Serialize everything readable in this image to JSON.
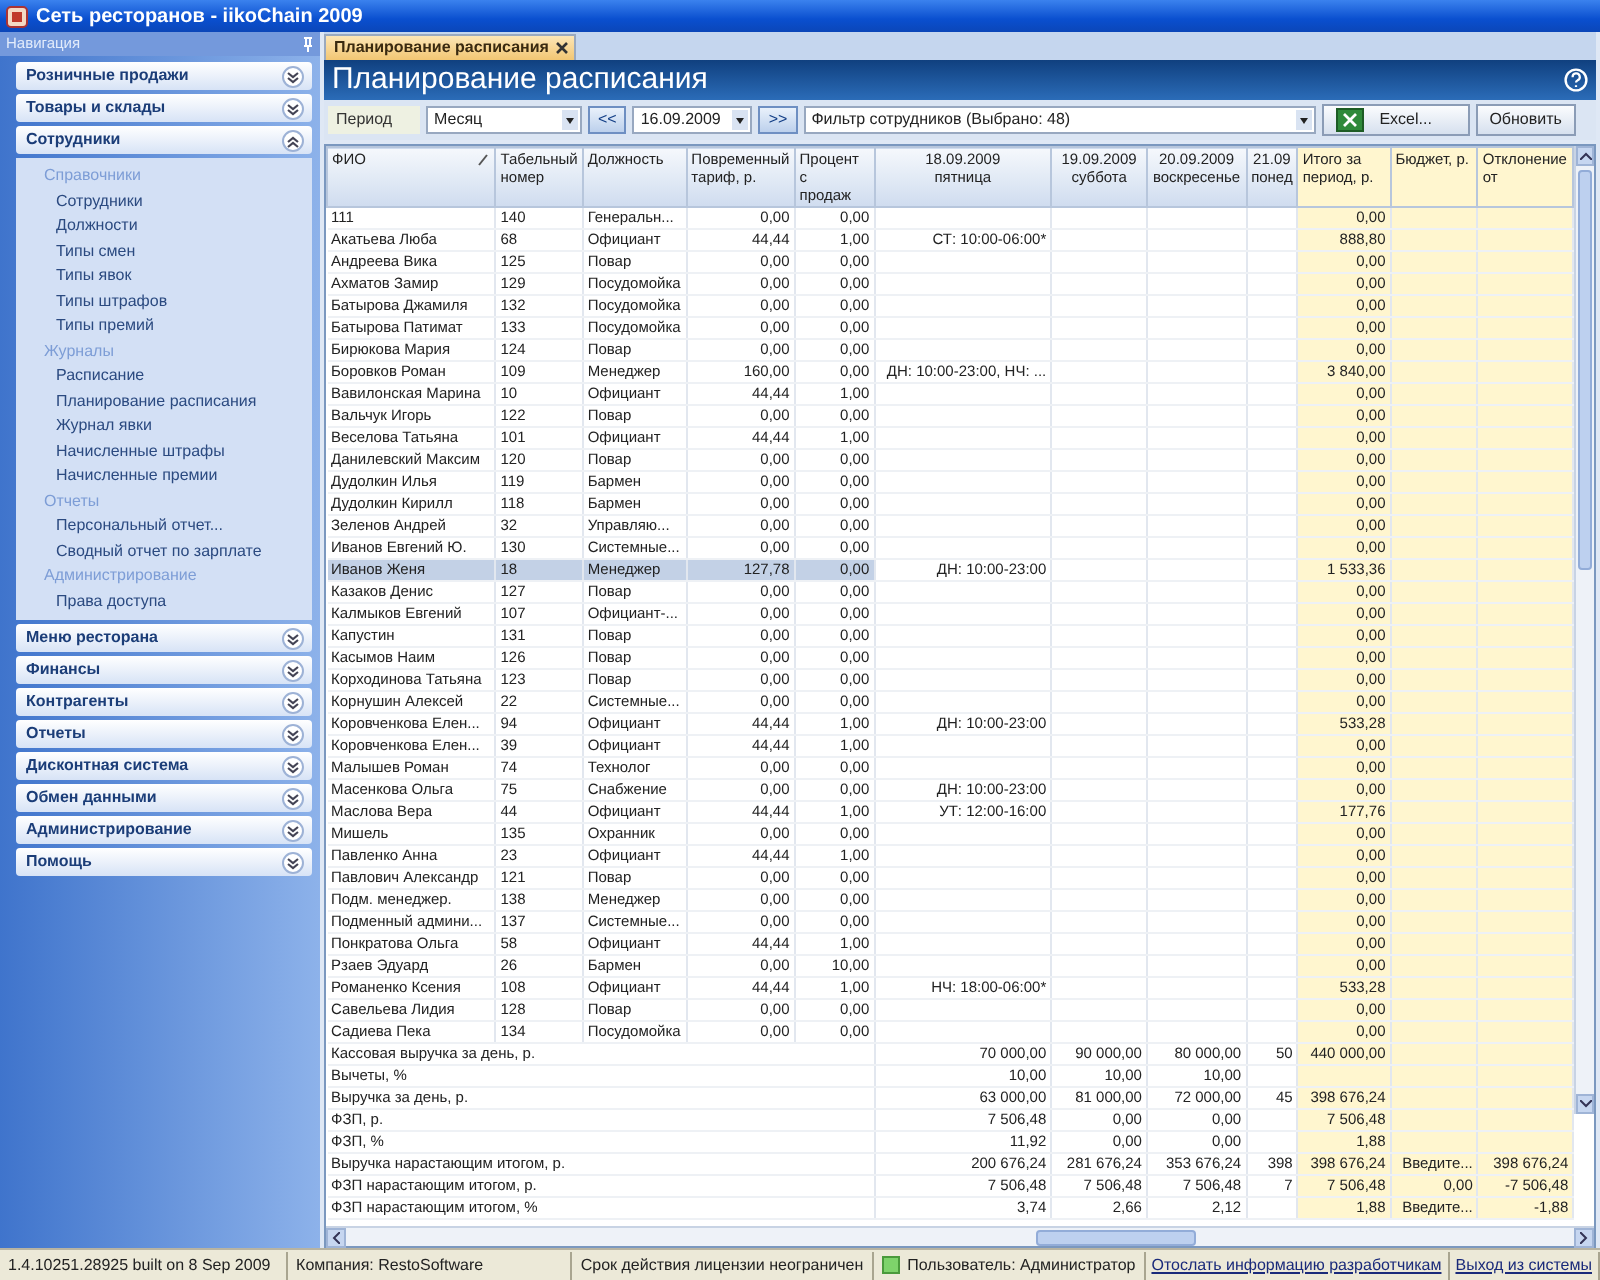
{
  "window": {
    "title": "Сеть ресторанов - iikoChain 2009"
  },
  "navigation": {
    "title": "Навигация",
    "sections": [
      {
        "label": "Розничные продажи",
        "expanded": false
      },
      {
        "label": "Товары и склады",
        "expanded": false
      },
      {
        "label": "Сотрудники",
        "expanded": true,
        "groups": [
          {
            "label": "Справочники",
            "items": [
              "Сотрудники",
              "Должности",
              "Типы смен",
              "Типы явок",
              "Типы штрафов",
              "Типы премий"
            ]
          },
          {
            "label": "Журналы",
            "items": [
              "Расписание",
              "Планирование расписания",
              "Журнал явки",
              "Начисленные штрафы",
              "Начисленные премии"
            ]
          },
          {
            "label": "Отчеты",
            "items": [
              "Персональный отчет...",
              "Сводный отчет по зарплате"
            ]
          },
          {
            "label": "Администрирование",
            "items": [
              "Права доступа"
            ]
          }
        ]
      },
      {
        "label": "Меню ресторана",
        "expanded": false
      },
      {
        "label": "Финансы",
        "expanded": false
      },
      {
        "label": "Контрагенты",
        "expanded": false
      },
      {
        "label": "Отчеты",
        "expanded": false
      },
      {
        "label": "Дисконтная система",
        "expanded": false
      },
      {
        "label": "Обмен данными",
        "expanded": false
      },
      {
        "label": "Администрирование",
        "expanded": false
      },
      {
        "label": "Помощь",
        "expanded": false
      }
    ]
  },
  "tab": {
    "label": "Планирование расписания"
  },
  "page_title": "Планирование расписания",
  "toolbar": {
    "period_label": "Период",
    "period": "Месяц",
    "prev": "<<",
    "date": "16.09.2009",
    "next": ">>",
    "filter": "Фильтр сотрудников (Выбрано: 48)",
    "excel": "Excel...",
    "refresh": "Обновить"
  },
  "table": {
    "columns": [
      {
        "lines": [
          "ФИО"
        ],
        "sorted": true
      },
      {
        "lines": [
          "Табельный",
          "номер"
        ],
        "sorted": false
      },
      {
        "lines": [
          "Должность"
        ],
        "sorted": false
      },
      {
        "lines": [
          "Повременный",
          "тариф, р."
        ],
        "sorted": false
      },
      {
        "lines": [
          "Процент с",
          "продаж"
        ],
        "sorted": false
      },
      {
        "lines": [
          "18.09.2009",
          "пятница"
        ],
        "sorted": false
      },
      {
        "lines": [
          "19.09.2009",
          "суббота"
        ],
        "sorted": false
      },
      {
        "lines": [
          "20.09.2009",
          "воскресенье"
        ],
        "sorted": false
      },
      {
        "lines": [
          "21.09",
          "понед"
        ],
        "sorted": false
      },
      {
        "lines": [
          "Итого за",
          "период, р."
        ],
        "sorted": false
      },
      {
        "lines": [
          "Бюджет, р."
        ],
        "sorted": false
      },
      {
        "lines": [
          "Отклонение",
          "от"
        ],
        "sorted": false
      }
    ],
    "rows": [
      {
        "name": "111",
        "number": "140",
        "position": "Генеральн...",
        "tariff": "0,00",
        "percent": "0,00",
        "total": "0,00",
        "selected": false
      },
      {
        "name": "Акатьева Люба",
        "number": "68",
        "position": "Официант",
        "tariff": "44,44",
        "percent": "1,00",
        "day_1": "СТ: 10:00-06:00*",
        "total": "888,80",
        "selected": false
      },
      {
        "name": "Андреева Вика",
        "number": "125",
        "position": "Повар",
        "tariff": "0,00",
        "percent": "0,00",
        "total": "0,00",
        "selected": false
      },
      {
        "name": "Ахматов Замир",
        "number": "129",
        "position": "Посудомойка",
        "tariff": "0,00",
        "percent": "0,00",
        "total": "0,00",
        "selected": false
      },
      {
        "name": "Батырова Джамиля",
        "number": "132",
        "position": "Посудомойка",
        "tariff": "0,00",
        "percent": "0,00",
        "total": "0,00",
        "selected": false
      },
      {
        "name": "Батырова Патимат",
        "number": "133",
        "position": "Посудомойка",
        "tariff": "0,00",
        "percent": "0,00",
        "total": "0,00",
        "selected": false
      },
      {
        "name": "Бирюкова Мария",
        "number": "124",
        "position": "Повар",
        "tariff": "0,00",
        "percent": "0,00",
        "total": "0,00",
        "selected": false
      },
      {
        "name": "Боровков Роман",
        "number": "109",
        "position": "Менеджер",
        "tariff": "160,00",
        "percent": "0,00",
        "day_1": "ДН: 10:00-23:00, НЧ: ...",
        "total": "3 840,00",
        "selected": false
      },
      {
        "name": "Вавилонская Марина",
        "number": "10",
        "position": "Официант",
        "tariff": "44,44",
        "percent": "1,00",
        "total": "0,00",
        "selected": false
      },
      {
        "name": "Вальчук Игорь",
        "number": "122",
        "position": "Повар",
        "tariff": "0,00",
        "percent": "0,00",
        "total": "0,00",
        "selected": false
      },
      {
        "name": "Веселова Татьяна",
        "number": "101",
        "position": "Официант",
        "tariff": "44,44",
        "percent": "1,00",
        "total": "0,00",
        "selected": false
      },
      {
        "name": "Данилевский Максим",
        "number": "120",
        "position": "Повар",
        "tariff": "0,00",
        "percent": "0,00",
        "total": "0,00",
        "selected": false
      },
      {
        "name": "Дудолкин Илья",
        "number": "119",
        "position": "Бармен",
        "tariff": "0,00",
        "percent": "0,00",
        "total": "0,00",
        "selected": false
      },
      {
        "name": "Дудолкин Кирилл",
        "number": "118",
        "position": "Бармен",
        "tariff": "0,00",
        "percent": "0,00",
        "total": "0,00",
        "selected": false
      },
      {
        "name": "Зеленов Андрей",
        "number": "32",
        "position": "Управляю...",
        "tariff": "0,00",
        "percent": "0,00",
        "total": "0,00",
        "selected": false
      },
      {
        "name": "Иванов Евгений Ю.",
        "number": "130",
        "position": "Системные...",
        "tariff": "0,00",
        "percent": "0,00",
        "total": "0,00",
        "selected": false
      },
      {
        "name": "Иванов Женя",
        "number": "18",
        "position": "Менеджер",
        "tariff": "127,78",
        "percent": "0,00",
        "day_1": "ДН: 10:00-23:00",
        "total": "1 533,36",
        "selected": true
      },
      {
        "name": "Казаков Денис",
        "number": "127",
        "position": "Повар",
        "tariff": "0,00",
        "percent": "0,00",
        "total": "0,00",
        "selected": false
      },
      {
        "name": "Калмыков Евгений",
        "number": "107",
        "position": "Официант-...",
        "tariff": "0,00",
        "percent": "0,00",
        "total": "0,00",
        "selected": false
      },
      {
        "name": "Капустин",
        "number": "131",
        "position": "Повар",
        "tariff": "0,00",
        "percent": "0,00",
        "total": "0,00",
        "selected": false
      },
      {
        "name": "Касымов Наим",
        "number": "126",
        "position": "Повар",
        "tariff": "0,00",
        "percent": "0,00",
        "total": "0,00",
        "selected": false
      },
      {
        "name": "Корходинова Татьяна",
        "number": "123",
        "position": "Повар",
        "tariff": "0,00",
        "percent": "0,00",
        "total": "0,00",
        "selected": false
      },
      {
        "name": "Корнушин Алексей",
        "number": "22",
        "position": "Системные...",
        "tariff": "0,00",
        "percent": "0,00",
        "total": "0,00",
        "selected": false
      },
      {
        "name": "Коровченкова Елен...",
        "number": "94",
        "position": "Официант",
        "tariff": "44,44",
        "percent": "1,00",
        "day_1": "ДН: 10:00-23:00",
        "total": "533,28",
        "selected": false
      },
      {
        "name": "Коровченкова Елен...",
        "number": "39",
        "position": "Официант",
        "tariff": "44,44",
        "percent": "1,00",
        "total": "0,00",
        "selected": false
      },
      {
        "name": "Малышев Роман",
        "number": "74",
        "position": "Технолог",
        "tariff": "0,00",
        "percent": "0,00",
        "total": "0,00",
        "selected": false
      },
      {
        "name": "Масенкова Ольга",
        "number": "75",
        "position": "Снабжение",
        "tariff": "0,00",
        "percent": "0,00",
        "day_1": "ДН: 10:00-23:00",
        "total": "0,00",
        "selected": false
      },
      {
        "name": "Маслова Вера",
        "number": "44",
        "position": "Официант",
        "tariff": "44,44",
        "percent": "1,00",
        "day_1": "УТ: 12:00-16:00",
        "total": "177,76",
        "selected": false
      },
      {
        "name": "Мишель",
        "number": "135",
        "position": "Охранник",
        "tariff": "0,00",
        "percent": "0,00",
        "total": "0,00",
        "selected": false
      },
      {
        "name": "Павленко Анна",
        "number": "23",
        "position": "Официант",
        "tariff": "44,44",
        "percent": "1,00",
        "total": "0,00",
        "selected": false
      },
      {
        "name": "Павлович Александр",
        "number": "121",
        "position": "Повар",
        "tariff": "0,00",
        "percent": "0,00",
        "total": "0,00",
        "selected": false
      },
      {
        "name": "Подм. менеджер.",
        "number": "138",
        "position": "Менеджер",
        "tariff": "0,00",
        "percent": "0,00",
        "total": "0,00",
        "selected": false
      },
      {
        "name": "Подменный админи...",
        "number": "137",
        "position": "Системные...",
        "tariff": "0,00",
        "percent": "0,00",
        "total": "0,00",
        "selected": false
      },
      {
        "name": "Понкратова Ольга",
        "number": "58",
        "position": "Официант",
        "tariff": "44,44",
        "percent": "1,00",
        "total": "0,00",
        "selected": false
      },
      {
        "name": "Рзаев Эдуард",
        "number": "26",
        "position": "Бармен",
        "tariff": "0,00",
        "percent": "10,00",
        "total": "0,00",
        "selected": false
      },
      {
        "name": "Романенко Ксения",
        "number": "108",
        "position": "Официант",
        "tariff": "44,44",
        "percent": "1,00",
        "day_1": "НЧ: 18:00-06:00*",
        "total": "533,28",
        "selected": false
      },
      {
        "name": "Савельева Лидия",
        "number": "128",
        "position": "Повар",
        "tariff": "0,00",
        "percent": "0,00",
        "total": "0,00",
        "selected": false
      },
      {
        "name": "Садиева Пека",
        "number": "134",
        "position": "Посудомойка",
        "tariff": "0,00",
        "percent": "0,00",
        "total": "0,00",
        "selected": false
      }
    ],
    "summary": [
      {
        "label": "Кассовая выручка за день, р.",
        "day_1": "70 000,00",
        "day_2": "90 000,00",
        "day_3": "80 000,00",
        "day_4": "50",
        "total": "440 000,00"
      },
      {
        "label": "Вычеты, %",
        "day_1": "10,00",
        "day_2": "10,00",
        "day_3": "10,00"
      },
      {
        "label": "Выручка за день, р.",
        "day_1": "63 000,00",
        "day_2": "81 000,00",
        "day_3": "72 000,00",
        "day_4": "45",
        "total": "398 676,24"
      },
      {
        "label": "ФЗП, р.",
        "day_1": "7 506,48",
        "day_2": "0,00",
        "day_3": "0,00",
        "total": "7 506,48"
      },
      {
        "label": "ФЗП, %",
        "day_1": "11,92",
        "day_2": "0,00",
        "day_3": "0,00",
        "total": "1,88"
      },
      {
        "label": "Выручка нарастающим итогом, р.",
        "day_1": "200 676,24",
        "day_2": "281 676,24",
        "day_3": "353 676,24",
        "day_4": "398",
        "total": "398 676,24",
        "budget": "Введите...",
        "deviation": "398 676,24"
      },
      {
        "label": "ФЗП нарастающим итогом, р.",
        "day_1": "7 506,48",
        "day_2": "7 506,48",
        "day_3": "7 506,48",
        "day_4": "7",
        "total": "7 506,48",
        "budget": "0,00",
        "deviation": "-7 506,48"
      },
      {
        "label": "ФЗП нарастающим итогом, %",
        "day_1": "3,74",
        "day_2": "2,66",
        "day_3": "2,12",
        "total": "1,88",
        "budget": "Введите...",
        "deviation": "-1,88"
      }
    ]
  },
  "status_bar": {
    "version": "1.4.10251.28925 built on 8 Sep 2009",
    "company": "Компания: RestoSoftware",
    "license": "Срок действия лицензии неограничен",
    "user": "Пользователь: Администратор",
    "send_info": "Отослать информацию разработчикам",
    "logout": "Выход из системы"
  }
}
